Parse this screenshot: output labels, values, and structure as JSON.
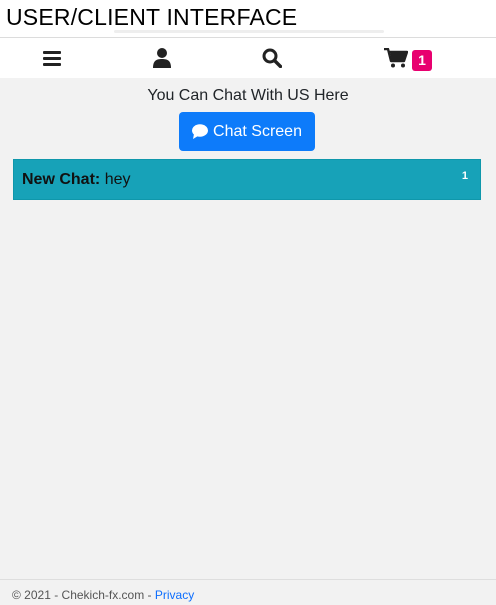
{
  "header": {
    "title": "USER/CLIENT INTERFACE"
  },
  "navbar": {
    "icons": [
      "menu-icon",
      "user-icon",
      "search-icon",
      "cart-icon"
    ],
    "cart_count": "1"
  },
  "main": {
    "intro_text": "You Can Chat With US Here",
    "chat_button_label": "Chat Screen",
    "chat_button_icon": "comment-icon",
    "chats": [
      {
        "label": "New Chat:",
        "message": "hey",
        "count": "1"
      }
    ]
  },
  "footer": {
    "copyright": "© 2021 - Chekich-fx.com - ",
    "privacy_link": "Privacy"
  },
  "colors": {
    "primary_button": "#0d7bfa",
    "chat_item_bg": "#17a2b8",
    "cart_badge": "#e8006f",
    "link": "#0d6efd"
  }
}
